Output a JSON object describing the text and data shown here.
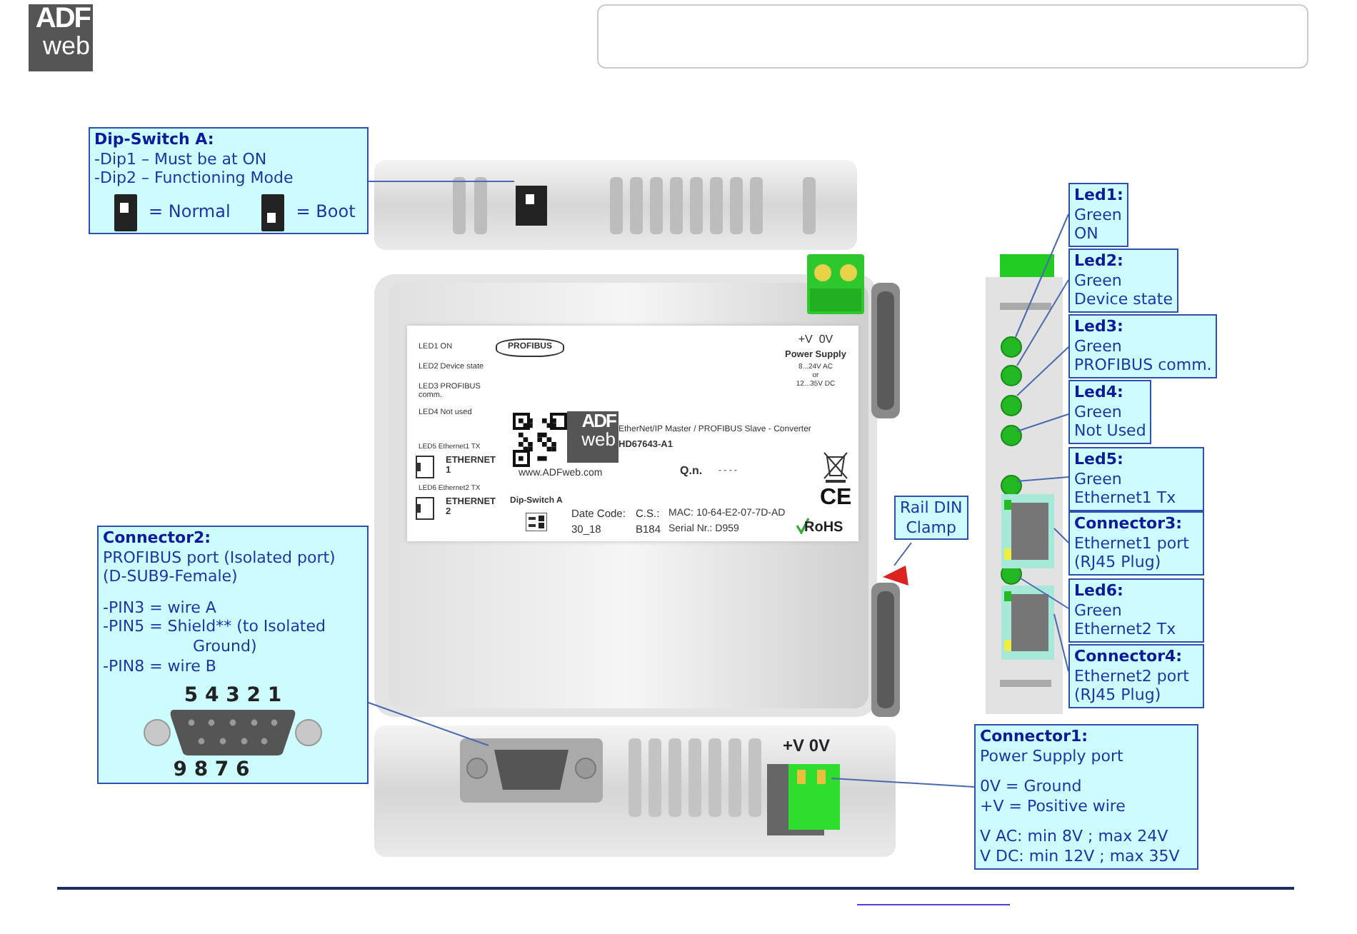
{
  "logo": {
    "top": "ADF",
    "bottom": "web"
  },
  "device_label": {
    "led_legend": [
      "LED1 ON",
      "LED2 Device state",
      "LED3 PROFIBUS comm.",
      "LED4 Not used"
    ],
    "profibus": "PROFIBUS",
    "power": [
      "+V  0V",
      "Power Supply",
      "8...24V AC",
      "or",
      "12...35V DC"
    ],
    "logo": {
      "top": "ADF",
      "bottom": "web"
    },
    "website": "www.ADFweb.com",
    "product": "EtherNet/IP Master / PROFIBUS Slave - Converter",
    "code": "HD67643-A1",
    "ethernet": [
      {
        "led": "LED5 Ethernet1 TX",
        "port": "ETHERNET 1"
      },
      {
        "led": "LED6 Ethernet2 TX",
        "port": "ETHERNET 2"
      }
    ],
    "qn_label": "Q.n.",
    "qn_value": "- - - -",
    "dip_title": "Dip-Switch A",
    "fields": [
      {
        "label": "Date Code:",
        "value": "30_18"
      },
      {
        "label": "C.S.:",
        "value": "B184"
      },
      {
        "label": "MAC: 10-64-E2-07-7D-AD",
        "value": "Serial Nr.: D959"
      }
    ],
    "ce": "CE",
    "rohs": "RoHS"
  },
  "bottom_terminal_label": "+V 0V",
  "callouts": [
    {
      "kind": "dip",
      "title": "Dip-Switch A:",
      "groups": [
        [
          "-Dip1 – Must be at ON",
          "-Dip2 – Functioning Mode"
        ]
      ],
      "modes": [
        {
          "label": "= Normal",
          "dip2_on": false
        },
        {
          "label": "= Boot",
          "dip2_on": true
        }
      ]
    },
    {
      "kind": "pinout",
      "title": "Connector2:",
      "groups": [
        [
          "PROFIBUS port (Isolated port)",
          "(D-SUB9-Female)"
        ],
        [
          "-PIN3 = wire A",
          "-PIN5 = Shield** (to Isolated Ground)",
          "-PIN8 = wire B"
        ]
      ],
      "pins_top": "5 4 3 2 1",
      "pins_bottom": "9 8 7 6"
    },
    {
      "kind": "plain",
      "title": "Led1:",
      "groups": [
        [
          "Green",
          "ON"
        ]
      ]
    },
    {
      "kind": "plain",
      "title": "Led2:",
      "groups": [
        [
          "Green",
          "Device state"
        ]
      ]
    },
    {
      "kind": "plain",
      "title": "Led3:",
      "groups": [
        [
          "Green",
          "PROFIBUS comm."
        ]
      ]
    },
    {
      "kind": "plain",
      "title": "Led4:",
      "groups": [
        [
          "Green",
          "Not Used"
        ]
      ]
    },
    {
      "kind": "plain",
      "title": "Led5:",
      "groups": [
        [
          "Green",
          "Ethernet1 Tx"
        ]
      ]
    },
    {
      "kind": "plain",
      "title": "Connector3:",
      "groups": [
        [
          "Ethernet1 port",
          "(RJ45 Plug)"
        ]
      ]
    },
    {
      "kind": "plain",
      "title": "Led6:",
      "groups": [
        [
          "Green",
          "Ethernet2 Tx"
        ]
      ]
    },
    {
      "kind": "plain",
      "title": "Connector4:",
      "groups": [
        [
          "Ethernet2 port",
          "(RJ45 Plug)"
        ]
      ]
    },
    {
      "kind": "note",
      "groups": [
        [
          "Rail DIN",
          "Clamp"
        ]
      ]
    },
    {
      "kind": "plain",
      "title": "Connector1:",
      "groups": [
        [
          "Power Supply port"
        ],
        [
          "0V = Ground",
          "+V = Positive wire"
        ],
        [
          "V AC: min 8V ; max 24V",
          "V DC: min 12V ; max 35V"
        ]
      ]
    }
  ]
}
